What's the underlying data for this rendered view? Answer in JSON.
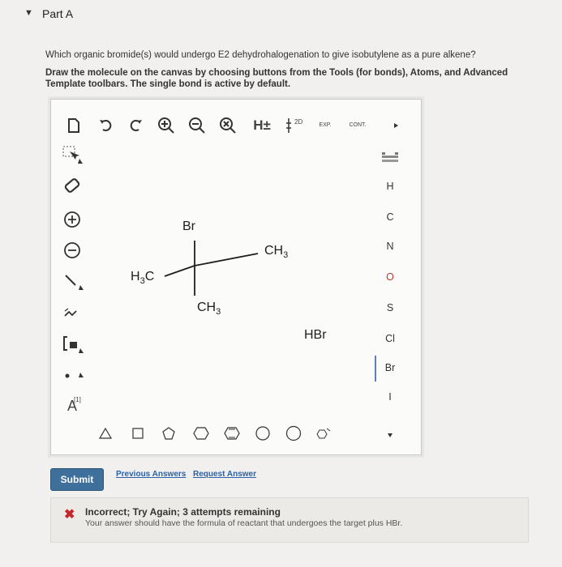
{
  "part": {
    "caret": "▼",
    "title": "Part A"
  },
  "question": "Which organic bromide(s) would undergo E2 dehydrohalogenation to give isobutylene as a pure alkene?",
  "instructions": "Draw the molecule on the canvas by choosing buttons from the Tools (for bonds), Atoms, and Advanced Template toolbars. The single bond is active by default.",
  "toolbar": {
    "hplus_label": "H±",
    "twod_label": "2D",
    "exp_label": "EXP.",
    "cont_label": "CONT."
  },
  "left_toolbar": {
    "isotope_label": "A",
    "isotope_sup": "[1]"
  },
  "atoms": [
    "H",
    "C",
    "N",
    "O",
    "S",
    "Cl",
    "Br",
    "I"
  ],
  "canvas": {
    "br_label": "Br",
    "ch3_right": "CH",
    "ch3_right_sub": "3",
    "h3c_left_h": "H",
    "h3c_left_sub": "3",
    "h3c_left_c": "C",
    "ch3_bottom": "CH",
    "ch3_bottom_sub": "3",
    "hbr_label": "HBr"
  },
  "actions": {
    "submit": "Submit",
    "previous_answers": "Previous Answers",
    "request_answer": "Request Answer"
  },
  "feedback": {
    "icon": "✖",
    "title": "Incorrect; Try Again; 3 attempts remaining",
    "message": "Your answer should have the formula of reactant that undergoes the target plus HBr."
  },
  "colors": {
    "submit_bg": "#3f6f9b",
    "error_red": "#c3272b",
    "link_blue": "#2a61a8",
    "accent_blue": "#5d7fb7"
  }
}
